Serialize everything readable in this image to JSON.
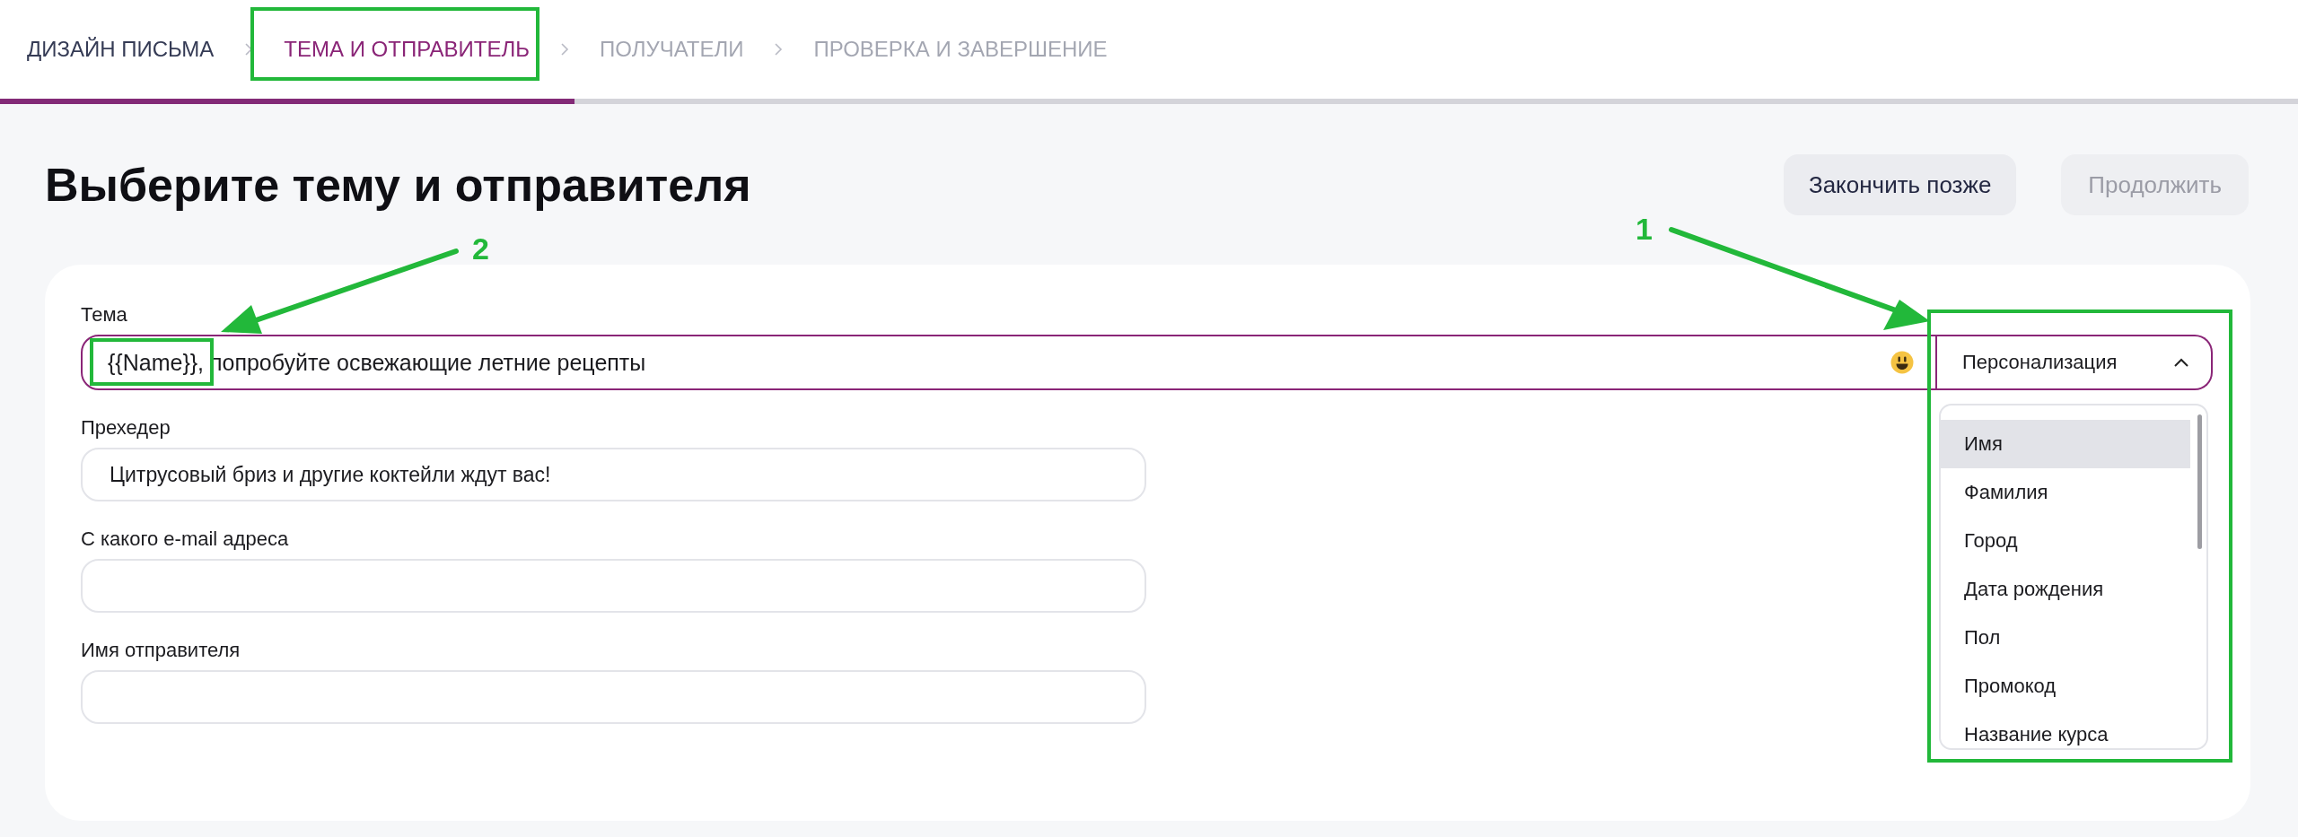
{
  "breadcrumbs": [
    {
      "label": "ДИЗАЙН ПИСЬМА",
      "selected": false,
      "disabled": false
    },
    {
      "label": "ТЕМА И ОТПРАВИТЕЛЬ",
      "selected": true,
      "disabled": false
    },
    {
      "label": "ПОЛУЧАТЕЛИ",
      "selected": false,
      "disabled": true
    },
    {
      "label": "ПРОВЕРКА И ЗАВЕРШЕНИЕ",
      "selected": false,
      "disabled": true
    }
  ],
  "progress": {
    "level": 0.25
  },
  "title": "Выберите тему и отправителя",
  "buttons": [
    {
      "label": "Закончить позже",
      "disabled": false
    },
    {
      "label": "Продолжить",
      "disabled": true
    }
  ],
  "subject": {
    "label": "Тема",
    "value": "{{Name}}, попробуйте освежающие летние рецепты",
    "personalization": {
      "label": "Персонализация",
      "expanded": true,
      "items": [
        {
          "label": "Имя",
          "selected": true
        },
        {
          "label": "Фамилия",
          "selected": false
        },
        {
          "label": "Город",
          "selected": false
        },
        {
          "label": "Дата рождения",
          "selected": false
        },
        {
          "label": "Пол",
          "selected": false
        },
        {
          "label": "Промокод",
          "selected": false
        },
        {
          "label": "Название курса",
          "selected": false
        }
      ]
    }
  },
  "fields": [
    {
      "label": "Прехедер",
      "value": "Цитрусовый бриз и другие коктейли ждут вас!"
    },
    {
      "label": "С какого e-mail адреса"
    },
    {
      "label": "Имя отправителя"
    }
  ],
  "annotations": [
    {
      "number": "1"
    },
    {
      "number": "2"
    }
  ]
}
